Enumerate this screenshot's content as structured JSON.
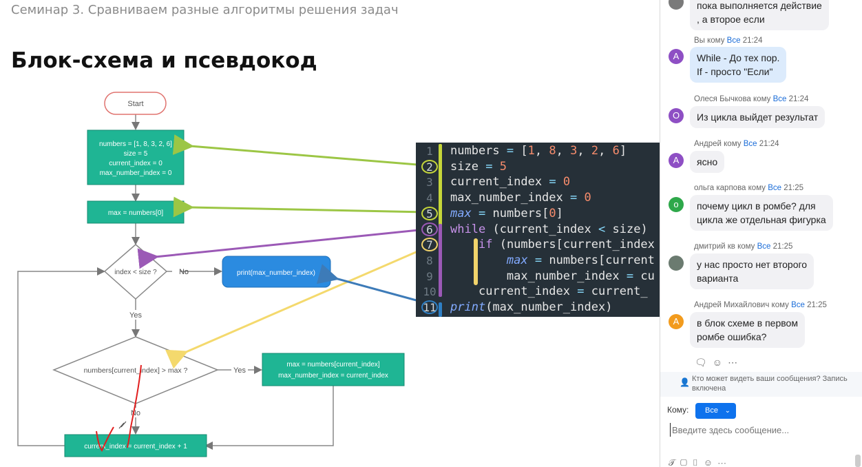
{
  "slide": {
    "seminar_title": "Семинар 3. Сравниваем разные алгоритмы решения задач",
    "heading": "Блок-схема и псевдокод",
    "flowchart": {
      "start": "Start",
      "init_lines": [
        "numbers = [1, 8, 3, 2, 6]",
        "size = 5",
        "current_index = 0",
        "max_number_index = 0"
      ],
      "max_assign": "max = numbers[0]",
      "cond1": "index < size ?",
      "no1": "No",
      "print": "print(max_number_index)",
      "yes1": "Yes",
      "cond2": "numbers[current_index] > max ?",
      "yes2": "Yes",
      "update_lines": [
        "max = numbers[current_index]",
        "max_number_index = current_index"
      ],
      "no2": "No",
      "increment": "current_index = current_index + 1",
      "colors": {
        "green": "#1fb594",
        "blue": "#2b8be0",
        "start_border": "#e0736f"
      }
    },
    "code": {
      "line_numbers": [
        "1",
        "2",
        "3",
        "4",
        "5",
        "6",
        "7",
        "8",
        "9",
        "10",
        "11"
      ],
      "markers": {
        "2": "#c5d63a",
        "5": "#c5d63a",
        "6": "#9b59b6",
        "7": "#f1d36b",
        "11": "#2e7fc4"
      },
      "lines": [
        "numbers = [1, 8, 3, 2, 6]",
        "size = 5",
        "current_index = 0",
        "max_number_index = 0",
        "max = numbers[0]",
        "while (current_index < size)",
        "    if (numbers[current_index",
        "        max = numbers[current",
        "        max_number_index = cu",
        "    current_index = current_",
        "print(max_number_index)"
      ]
    },
    "arrow_colors": {
      "green": "#9cc645",
      "purple": "#9b59b6",
      "yellow": "#f4d96d",
      "blue": "#3d7bb8"
    },
    "annotation_color": "#e11d1d"
  },
  "chat": {
    "messages": [
      {
        "header": "",
        "text_lines": [
          "пока  выполняется действие",
          ", а второе если"
        ],
        "avatar": "",
        "avatar_color": "#7a7a7a",
        "mine": false
      },
      {
        "from": "Вы",
        "kw": "кому",
        "to": "Все",
        "time": "21:24",
        "text_lines": [
          "While - До тех пор.",
          "If - просто \"Если\""
        ],
        "avatar": "A",
        "avatar_color": "#8e4fc4",
        "mine": true
      },
      {
        "from": "Олеся Бычкова",
        "kw": "кому",
        "to": "Все",
        "time": "21:24",
        "text_lines": [
          "Из цикла выйдет результат"
        ],
        "avatar": "O",
        "avatar_color": "#8e4fc4",
        "mine": false
      },
      {
        "from": "Андрей",
        "kw": "кому",
        "to": "Все",
        "time": "21:24",
        "text_lines": [
          "ясно"
        ],
        "avatar": "A",
        "avatar_color": "#8e4fc4",
        "mine": false
      },
      {
        "from": "ольга карпова",
        "kw": "кому",
        "to": "Все",
        "time": "21:25",
        "text_lines": [
          "почему цикл в ромбе? для",
          "цикла же отдельная фигурка"
        ],
        "avatar": "o",
        "avatar_color": "#2ea84a",
        "mine": false
      },
      {
        "from": "дмитрий кв",
        "kw": "кому",
        "to": "Все",
        "time": "21:25",
        "text_lines": [
          " у нас просто нет второго",
          "варианта"
        ],
        "avatar": "",
        "avatar_color": "#6b7b70",
        "mine": false
      },
      {
        "from": "Андрей Михайлович",
        "kw": "кому",
        "to": "Все",
        "time": "21:25",
        "text_lines": [
          "в блок схеме в первом",
          "ромбе ошибка?"
        ],
        "avatar": "A",
        "avatar_color": "#f29b1d",
        "mine": false
      }
    ],
    "notice": "Кто может видеть ваши сообщения? Запись включена",
    "to_label": "Кому:",
    "to_value": "Все",
    "input_placeholder": "Введите здесь сообщение..."
  }
}
